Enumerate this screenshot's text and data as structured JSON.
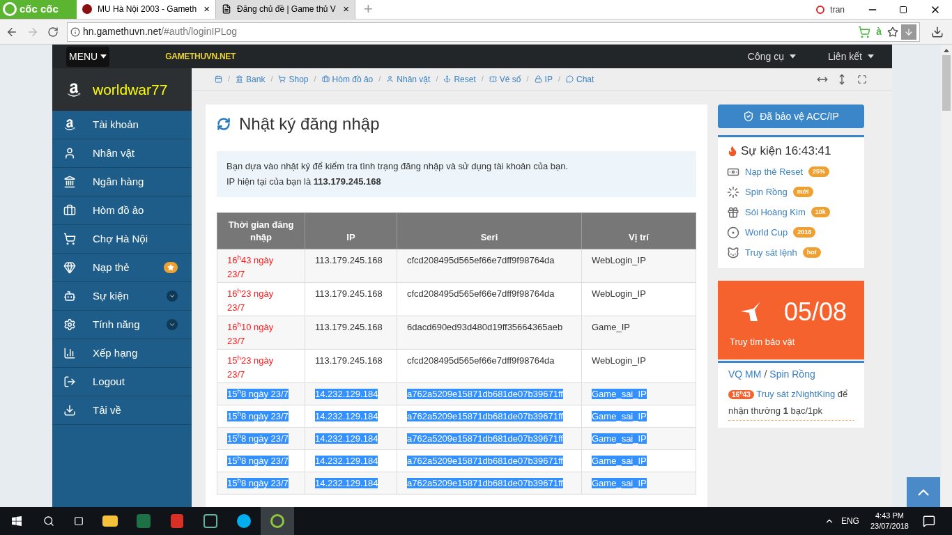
{
  "browser": {
    "brand": "cốc cốc",
    "tabs": [
      {
        "title": "MU Hà Nội 2003 - Gameth",
        "selected": true,
        "close": "×"
      },
      {
        "title": "Đăng chủ đề | Game thủ V",
        "selected": false,
        "close": "×"
      }
    ],
    "new_tab": "+",
    "user": "tran",
    "url_host": "hn.gamethuvn.net",
    "url_path": "/#auth/loginIPLog",
    "extension_text": "à"
  },
  "topbar": {
    "menu": "MENU",
    "logo": "GAMETHUVN.NET",
    "links": [
      "Công cụ",
      "Liên kết"
    ]
  },
  "sidebar": {
    "username": "worldwar77",
    "items": [
      {
        "label": "Tài khoản",
        "kind": "plain"
      },
      {
        "label": "Nhân vật",
        "kind": "plain"
      },
      {
        "label": "Ngân hàng",
        "kind": "plain"
      },
      {
        "label": "Hòm đồ ảo",
        "kind": "plain"
      },
      {
        "label": "Chợ Hà Nội",
        "kind": "plain"
      },
      {
        "label": "Nạp thẻ",
        "kind": "star"
      },
      {
        "label": "Sự kiện",
        "kind": "dropdown"
      },
      {
        "label": "Tính năng",
        "kind": "dropdown"
      },
      {
        "label": "Xếp hạng",
        "kind": "plain"
      },
      {
        "label": "Logout",
        "kind": "plain"
      },
      {
        "label": "Tải về",
        "kind": "plain"
      }
    ]
  },
  "breadcrumb": {
    "separator": "/",
    "links": [
      "Bank",
      "Shop",
      "Hòm đồ ảo",
      "Nhân vật",
      "Reset",
      "Vé số",
      "IP",
      "Chat"
    ]
  },
  "panel": {
    "title": "Nhật ký đăng nhập",
    "info": "Bạn dựa vào nhật ký để kiểm tra tình trạng đăng nhập và sử dụng tài khoản của bạn.",
    "ip_line": "IP hiện tại của bạn là **113.179.245.168**"
  },
  "table": {
    "columns": [
      "Thời gian đăng nhập",
      "IP",
      "Seri",
      "Vị trí"
    ],
    "rows": [
      {
        "time": "16$^{h}$43 ngày 23/7",
        "ip": "113.179.245.168",
        "seri": "cfcd208495d565ef66e7dff9f98764da",
        "place": "WebLogin_IP",
        "selected": false
      },
      {
        "time": "16$^{h}$23 ngày 23/7",
        "ip": "113.179.245.168",
        "seri": "cfcd208495d565ef66e7dff9f98764da",
        "place": "WebLogin_IP",
        "selected": false
      },
      {
        "time": "16$^{h}$10 ngày 23/7",
        "ip": "113.179.245.168",
        "seri": "6dacd690ed93d480d19ff35664365aeb",
        "place": "Game_IP",
        "selected": false
      },
      {
        "time": "15$^{h}$23 ngày 23/7",
        "ip": "113.179.245.168",
        "seri": "cfcd208495d565ef66e7dff9f98764da",
        "place": "WebLogin_IP",
        "selected": false
      },
      {
        "time": "15$^{h}$8 ngày 23/7",
        "ip": "14.232.129.184",
        "seri": "a762a5209e15871db681de07b39671ff",
        "place": "Game_sai_IP",
        "selected": true
      },
      {
        "time": "15$^{h}$8 ngày 23/7",
        "ip": "14.232.129.184",
        "seri": "a762a5209e15871db681de07b39671ff",
        "place": "Game_sai_IP",
        "selected": true
      },
      {
        "time": "15$^{h}$8 ngày 23/7",
        "ip": "14.232.129.184",
        "seri": "a762a5209e15871db681de07b39671ff",
        "place": "Game_sai_IP",
        "selected": true
      },
      {
        "time": "15$^{h}$8 ngày 23/7",
        "ip": "14.232.129.184",
        "seri": "a762a5209e15871db681de07b39671ff",
        "place": "Game_sai_IP",
        "selected": true
      },
      {
        "time": "15$^{h}$8 ngày 23/7",
        "ip": "14.232.129.184",
        "seri": "a762a5209e15871db681de07b39671ff",
        "place": "Game_sai_IP",
        "selected": true
      }
    ]
  },
  "right": {
    "protect_button": "Đã bảo vệ ACC/IP",
    "events_title": "Sự kiện 16:43:41",
    "events": [
      {
        "label": "Nạp thẻ Reset",
        "badge": "25%"
      },
      {
        "label": "Spin Rồng",
        "badge": "mới"
      },
      {
        "label": "Sói Hoàng Kim",
        "badge": "10k"
      },
      {
        "label": "World Cup",
        "badge": "2018"
      },
      {
        "label": "Truy sát lệnh",
        "badge": "hot"
      }
    ],
    "treasure": {
      "count": "05/08",
      "label": "Truy tìm bảo vật"
    },
    "quest_links": [
      "VQ MM",
      "Spin Rồng"
    ],
    "quest_sep": "/",
    "quest_time": "16$^{h}$43",
    "quest_link": "Truy sát zNightKing",
    "quest_text": "để nhận thưởng **1** bạc/1pk"
  },
  "taskbar": {
    "lang": "ENG",
    "time": "4:43 PM",
    "date": "23/07/2018"
  }
}
